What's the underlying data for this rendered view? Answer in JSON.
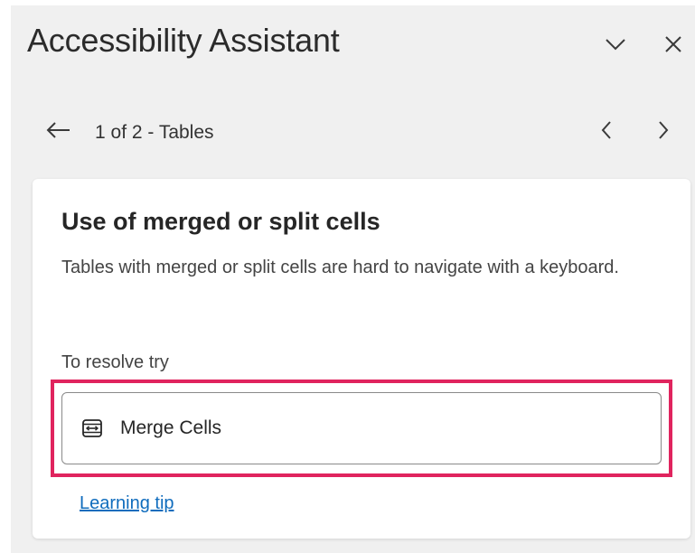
{
  "panel": {
    "title": "Accessibility Assistant",
    "collapse_icon": "chevron-down-icon",
    "close_icon": "close-icon"
  },
  "navigation": {
    "back_icon": "arrow-left-icon",
    "position_text": "1 of 2 - Tables",
    "prev_icon": "chevron-left-icon",
    "next_icon": "chevron-right-icon"
  },
  "issue": {
    "title": "Use of merged or split cells",
    "description": "Tables with merged or split cells are hard to navigate with a keyboard.",
    "resolve_label": "To resolve try",
    "action": {
      "label": "Merge Cells",
      "icon": "merge-cells-icon"
    },
    "learning_tip": "Learning tip"
  },
  "colors": {
    "highlight": "#e0245e",
    "link": "#0f6cbd",
    "pane_background": "#f0f0f0"
  }
}
